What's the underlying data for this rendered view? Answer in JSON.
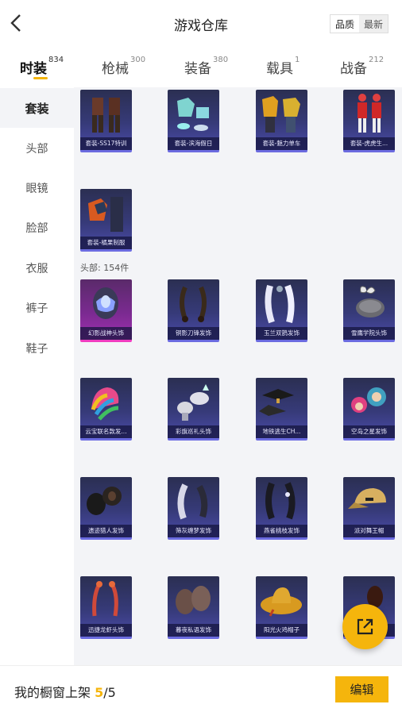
{
  "header": {
    "title": "游戏仓库",
    "sort_options": [
      "品质",
      "最新"
    ],
    "back_icon": "chevron-left-icon"
  },
  "tabs": [
    {
      "label": "时装",
      "count": "834",
      "active": true
    },
    {
      "label": "枪械",
      "count": "300",
      "active": false
    },
    {
      "label": "装备",
      "count": "380",
      "active": false
    },
    {
      "label": "载具",
      "count": "1",
      "active": false
    },
    {
      "label": "战备",
      "count": "212",
      "active": false
    }
  ],
  "sidebar": {
    "items": [
      {
        "label": "套装",
        "active": true
      },
      {
        "label": "头部",
        "active": false
      },
      {
        "label": "眼镜",
        "active": false
      },
      {
        "label": "脸部",
        "active": false
      },
      {
        "label": "衣服",
        "active": false
      },
      {
        "label": "裤子",
        "active": false
      },
      {
        "label": "鞋子",
        "active": false
      }
    ]
  },
  "suits": [
    {
      "label": "套装-SS17特训",
      "icon": "outfit-icon"
    },
    {
      "label": "套装-滨海假日",
      "icon": "outfit-icon"
    },
    {
      "label": "套装-魅力单车",
      "icon": "outfit-icon"
    },
    {
      "label": "套装-虎虎生...",
      "icon": "outfit-icon"
    },
    {
      "label": "套装-橘果制服",
      "icon": "outfit-icon"
    }
  ],
  "head_section": {
    "label": "头部: 154件"
  },
  "heads": [
    {
      "label": "幻影战神头饰",
      "rarity": "pink"
    },
    {
      "label": "铜影刀锋发饰",
      "rarity": "purple"
    },
    {
      "label": "玉兰双鹊发饰",
      "rarity": "purple"
    },
    {
      "label": "雪鹰学院头饰",
      "rarity": "purple"
    },
    {
      "label": "云宝联名款发...",
      "rarity": "purple"
    },
    {
      "label": "彩旗巡礼头饰",
      "rarity": "purple"
    },
    {
      "label": "地铁逃生CH...",
      "rarity": "purple"
    },
    {
      "label": "空岛之星发饰",
      "rarity": "purple"
    },
    {
      "label": "遗迹猎人发饰",
      "rarity": "purple"
    },
    {
      "label": "筛灰缠梦发饰",
      "rarity": "purple"
    },
    {
      "label": "燕雀桃枝发饰",
      "rarity": "purple"
    },
    {
      "label": "派对舞王帽",
      "rarity": "purple"
    },
    {
      "label": "迅捷龙虾头饰",
      "rarity": "purple"
    },
    {
      "label": "暮夜私语发饰",
      "rarity": "purple"
    },
    {
      "label": "阳光火鸡帽子",
      "rarity": "purple"
    },
    {
      "label": "",
      "rarity": "purple"
    }
  ],
  "fab": {
    "icon": "share-external-icon"
  },
  "footer": {
    "text": "我的橱窗上架",
    "count": "5",
    "separator": "/",
    "total": "5",
    "edit_label": "编辑"
  },
  "colors": {
    "accent": "#f5b50c",
    "card_purple": "#363a78",
    "card_pink": "#a030b0",
    "panel_bg": "#f3f4f7"
  }
}
